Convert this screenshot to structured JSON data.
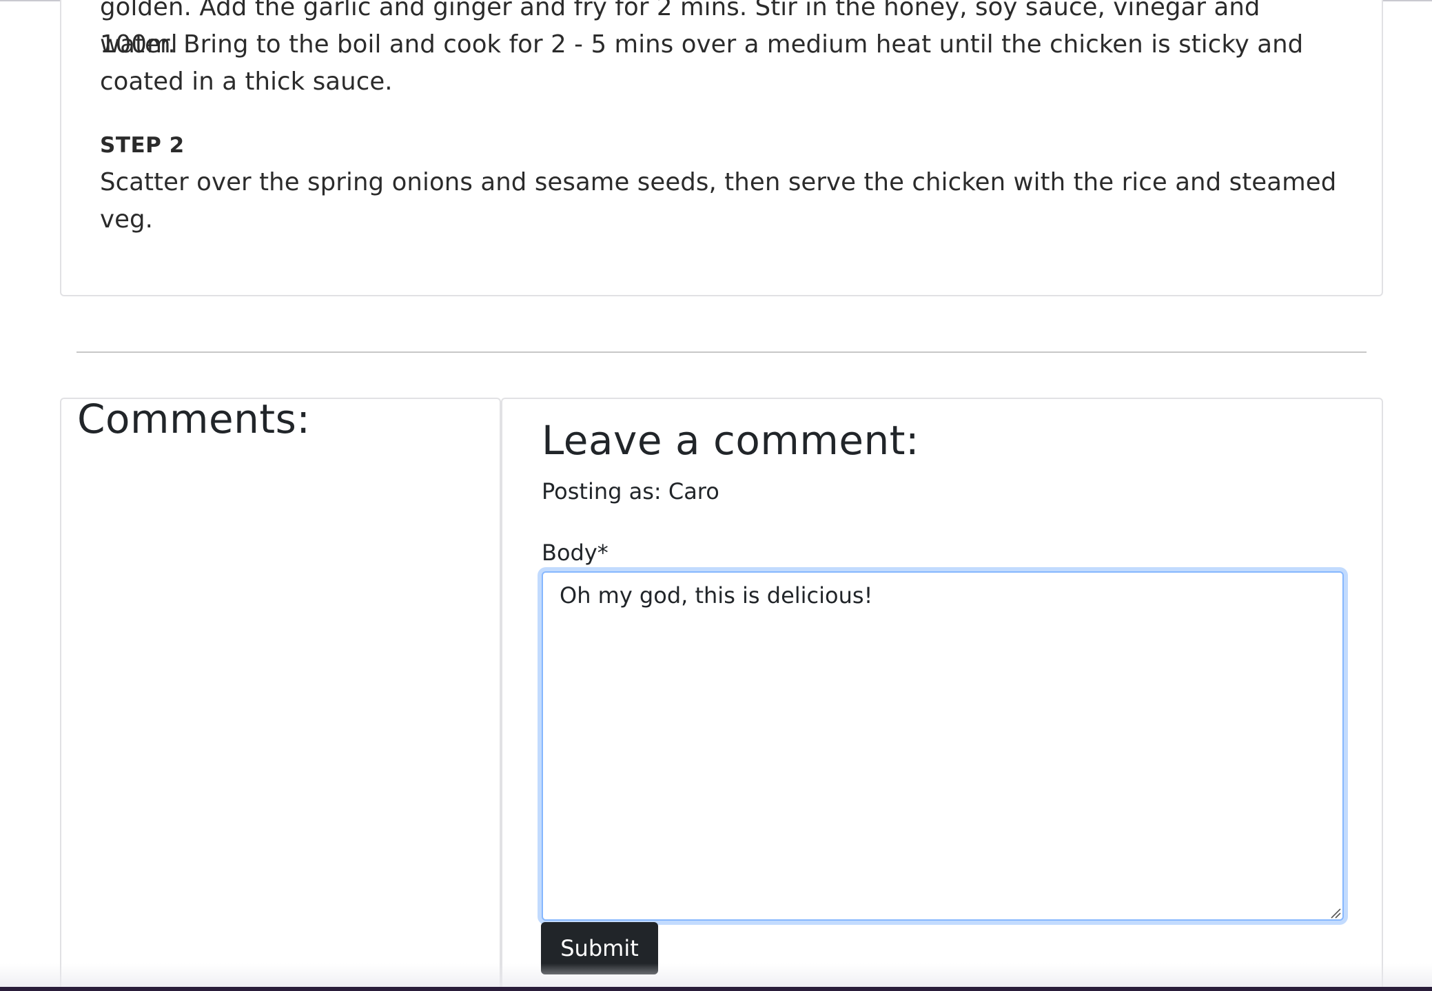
{
  "method": {
    "step1_tail_lines": [
      "golden. Add the garlic and ginger and fry for 2 mins. Stir in the honey, soy sauce, vinegar and 100ml",
      "water. Bring to the boil and cook for 2 - 5 mins over a medium heat until the chicken is sticky and",
      "coated in a thick sauce."
    ],
    "step2_heading": "STEP 2",
    "step2_lines": [
      "Scatter over the spring onions and sesame seeds, then serve the chicken with the rice and steamed",
      "veg."
    ]
  },
  "comments": {
    "heading": "Comments:"
  },
  "comment_form": {
    "heading": "Leave a comment:",
    "posting_as": "Posting as: Caro",
    "body_label": "Body*",
    "body_value": "Oh my god, this is delicious!",
    "submit_label": "Submit"
  },
  "colors": {
    "button_bg": "#212529",
    "focus_border": "#86b7fe",
    "card_border": "#e1e1e4"
  },
  "icons": {
    "resize_handle": "resize-grip-icon"
  }
}
